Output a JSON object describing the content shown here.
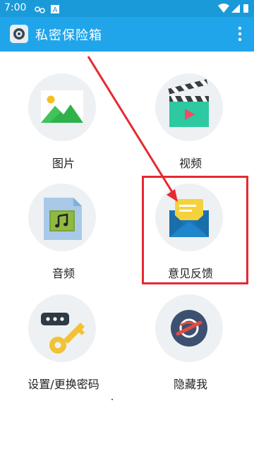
{
  "status_bar": {
    "time": "7:00",
    "icons_left": [
      "cloud-sync-icon",
      "text-a-icon"
    ],
    "icons_right": [
      "wifi-icon",
      "signal-icon",
      "battery-icon"
    ]
  },
  "app_bar": {
    "title": "私密保险箱",
    "icon": "safe-logo-icon",
    "menu_icon": "overflow-menu-icon"
  },
  "tiles": [
    {
      "label": "图片",
      "icon": "image-icon"
    },
    {
      "label": "视频",
      "icon": "video-clapper-icon"
    },
    {
      "label": "音频",
      "icon": "audio-file-icon"
    },
    {
      "label": "意见反馈",
      "icon": "feedback-mail-icon",
      "highlighted": true
    },
    {
      "label": "设置/更换密码",
      "icon": "password-key-icon"
    },
    {
      "label": "隐藏我",
      "icon": "hide-eye-icon"
    }
  ],
  "colors": {
    "status_bar": "#1a9ad9",
    "app_bar": "#21a5ea",
    "annotation": "#e52a31",
    "circle_bg": "#eef1f4"
  }
}
